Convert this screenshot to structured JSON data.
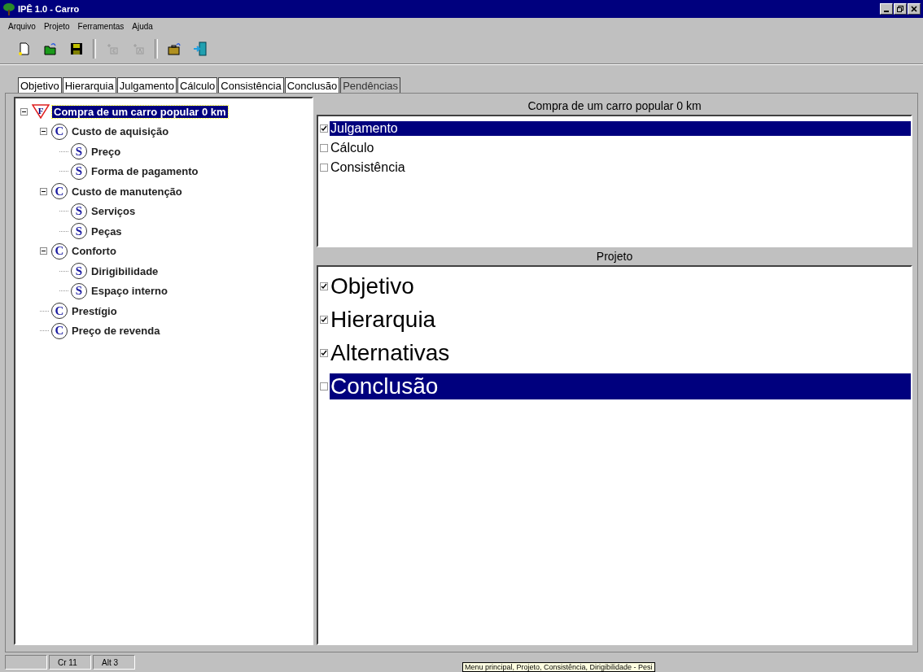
{
  "window": {
    "title": "IPÊ 1.0 - Carro"
  },
  "menu": [
    "Arquivo",
    "Projeto",
    "Ferramentas",
    "Ajuda"
  ],
  "toolbar": [
    {
      "kind": "new",
      "disabled": false
    },
    {
      "kind": "open",
      "disabled": false
    },
    {
      "kind": "save",
      "disabled": false
    },
    {
      "kind": "sep"
    },
    {
      "kind": "add-c",
      "disabled": true
    },
    {
      "kind": "add-a",
      "disabled": true
    },
    {
      "kind": "sep"
    },
    {
      "kind": "case",
      "disabled": false
    },
    {
      "kind": "exit",
      "disabled": false
    }
  ],
  "tabs": [
    {
      "label": "Objetivo",
      "selected": false
    },
    {
      "label": "Hierarquia",
      "selected": false
    },
    {
      "label": "Julgamento",
      "selected": false
    },
    {
      "label": "Cálculo",
      "selected": false
    },
    {
      "label": "Consistência",
      "selected": false
    },
    {
      "label": "Conclusão",
      "selected": false
    },
    {
      "label": "Pendências",
      "selected": true
    }
  ],
  "tree": [
    {
      "kind": "F",
      "label": "Compra de um carro popular 0 km",
      "selected": true,
      "expanded": true,
      "children": [
        {
          "kind": "C",
          "label": "Custo de aquisição",
          "selected": false,
          "expanded": true,
          "children": [
            {
              "kind": "S",
              "label": "Preço",
              "selected": false
            },
            {
              "kind": "S",
              "label": "Forma de pagamento",
              "selected": false
            }
          ]
        },
        {
          "kind": "C",
          "label": "Custo de manutenção",
          "selected": false,
          "expanded": true,
          "children": [
            {
              "kind": "S",
              "label": "Serviços",
              "selected": false
            },
            {
              "kind": "S",
              "label": "Peças",
              "selected": false
            }
          ]
        },
        {
          "kind": "C",
          "label": "Conforto",
          "selected": false,
          "expanded": true,
          "children": [
            {
              "kind": "S",
              "label": "Dirigibilidade",
              "selected": false
            },
            {
              "kind": "S",
              "label": "Espaço interno",
              "selected": false
            }
          ]
        },
        {
          "kind": "C",
          "label": "Prestígio",
          "selected": false
        },
        {
          "kind": "C",
          "label": "Preço de revenda",
          "selected": false
        }
      ]
    }
  ],
  "panels": [
    {
      "title": "Compra de um carro popular 0 km",
      "items": [
        {
          "label": "Julgamento",
          "checked": true,
          "selected": true
        },
        {
          "label": "Cálculo",
          "checked": false,
          "selected": false
        },
        {
          "label": "Consistência",
          "checked": false,
          "selected": false
        }
      ]
    },
    {
      "title": "Projeto",
      "items": [
        {
          "label": "Objetivo",
          "checked": true,
          "selected": false
        },
        {
          "label": "Hierarquia",
          "checked": true,
          "selected": false
        },
        {
          "label": "Alternativas",
          "checked": true,
          "selected": false
        },
        {
          "label": "Conclusão",
          "checked": false,
          "selected": true
        }
      ]
    }
  ],
  "status_bar": [
    "Cr 11",
    "Alt 3"
  ],
  "tooltip": "Menu principal, Projeto, Consistência, Dirigibilidade - Pesi"
}
